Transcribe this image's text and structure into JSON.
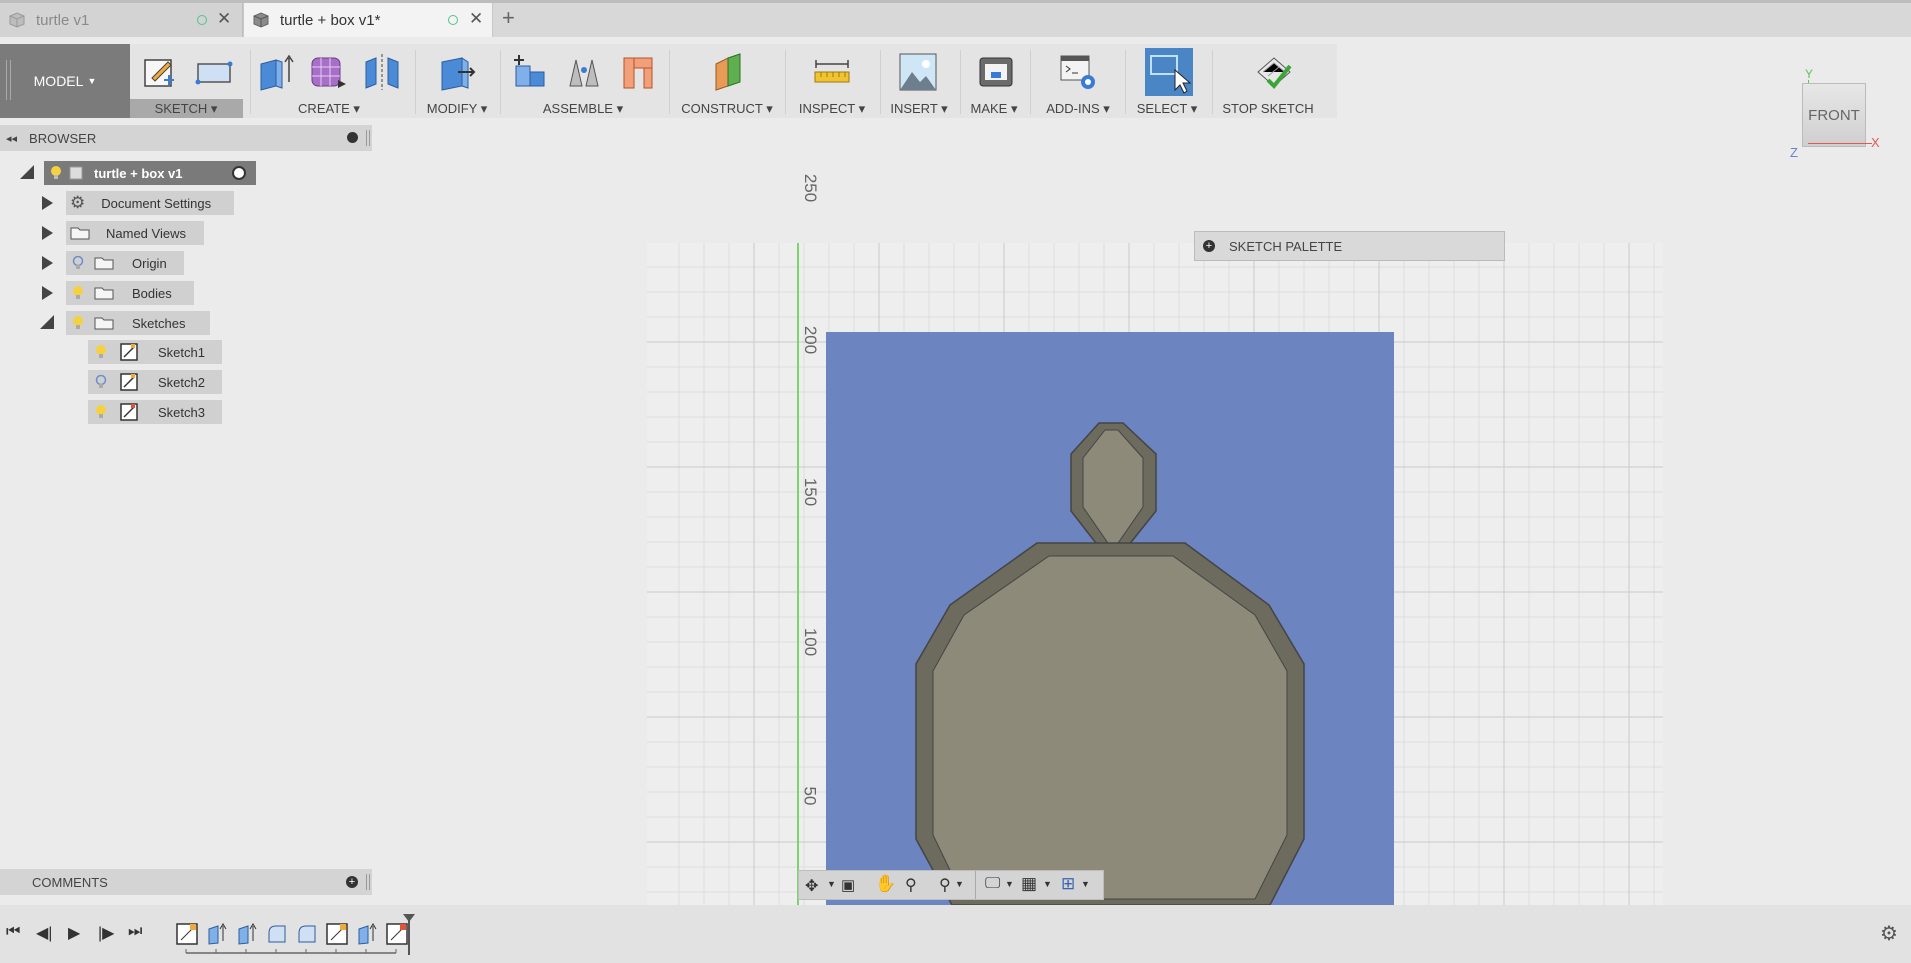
{
  "tabs": [
    {
      "title": "turtle v1",
      "active": false
    },
    {
      "title": "turtle + box v1*",
      "active": true
    }
  ],
  "toolbar": {
    "workspace": "MODEL",
    "groups": [
      {
        "label": "SKETCH"
      },
      {
        "label": "CREATE"
      },
      {
        "label": "MODIFY"
      },
      {
        "label": "ASSEMBLE"
      },
      {
        "label": "CONSTRUCT"
      },
      {
        "label": "INSPECT"
      },
      {
        "label": "INSERT"
      },
      {
        "label": "MAKE"
      },
      {
        "label": "ADD-INS"
      },
      {
        "label": "SELECT"
      },
      {
        "label": "STOP SKETCH"
      }
    ]
  },
  "browser": {
    "title": "BROWSER",
    "root": "turtle + box v1",
    "items": [
      {
        "label": "Document Settings",
        "icon": "gear-icon"
      },
      {
        "label": "Named Views",
        "icon": "folder-icon"
      },
      {
        "label": "Origin",
        "icon": "folder-icon"
      },
      {
        "label": "Bodies",
        "icon": "folder-icon"
      },
      {
        "label": "Sketches",
        "icon": "folder-icon"
      }
    ],
    "sketches": [
      "Sketch1",
      "Sketch2",
      "Sketch3"
    ]
  },
  "comments": {
    "title": "COMMENTS"
  },
  "sketch_palette": {
    "title": "SKETCH PALETTE"
  },
  "viewcube": {
    "face": "FRONT",
    "axis_y": "Y",
    "axis_x": "X",
    "axis_z": "Z"
  },
  "ruler": {
    "labels": [
      "250",
      "200",
      "150",
      "100",
      "50"
    ]
  },
  "colors": {
    "sketch_fill": "#6c84bf",
    "body": "#8e8a7a",
    "active_tab_status": "#4fc58a"
  }
}
